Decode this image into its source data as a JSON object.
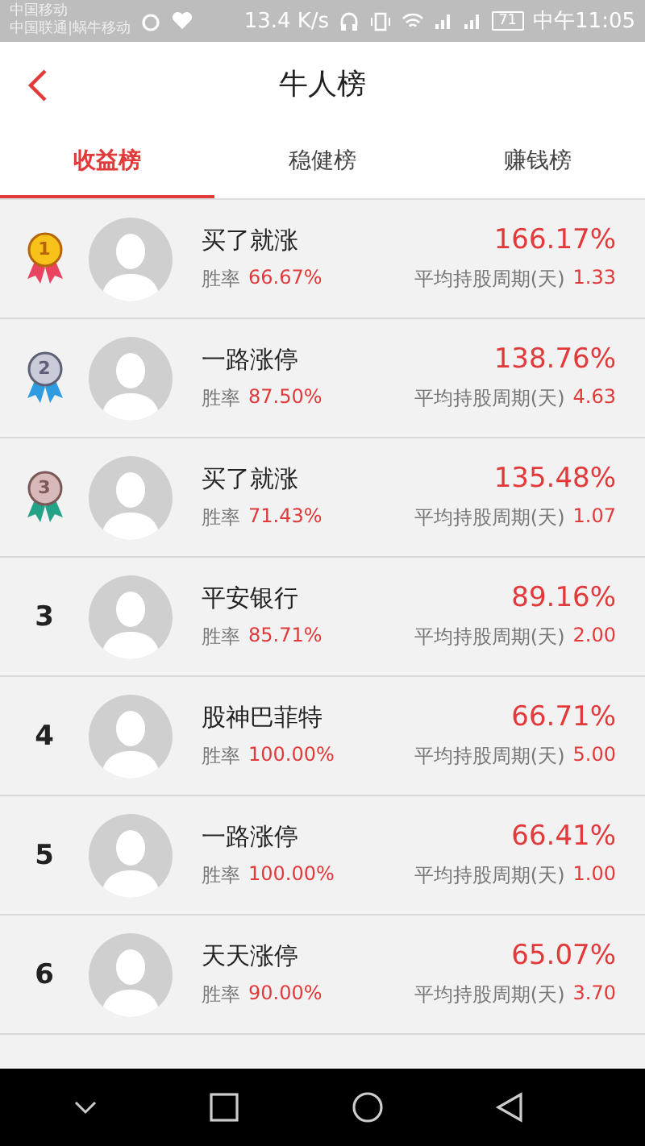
{
  "status_bar": {
    "carriers": [
      "中国移动",
      "中国联通|蜗牛移动"
    ],
    "speed": "13.4 K/s",
    "battery": "71",
    "time": "中午11:05"
  },
  "header": {
    "title": "牛人榜"
  },
  "tabs": [
    {
      "label": "收益榜",
      "selected": true
    },
    {
      "label": "稳健榜",
      "selected": false
    },
    {
      "label": "赚钱榜",
      "selected": false
    }
  ],
  "rows": [
    {
      "kind": "medal",
      "color": "#e94560",
      "rank": "1",
      "name": "买了就涨",
      "win_label": "胜率",
      "win_rate": "66.67%",
      "return": "166.17%",
      "period_label": "平均持股周期(天)",
      "period": "1.33"
    },
    {
      "kind": "medal",
      "color": "#2f9be0",
      "rank": "2",
      "name": "一路涨停",
      "win_label": "胜率",
      "win_rate": "87.50%",
      "return": "138.76%",
      "period_label": "平均持股周期(天)",
      "period": "4.63"
    },
    {
      "kind": "medal",
      "color": "#24a389",
      "rank": "3",
      "name": "买了就涨",
      "win_label": "胜率",
      "win_rate": "71.43%",
      "return": "135.48%",
      "period_label": "平均持股周期(天)",
      "period": "1.07"
    },
    {
      "kind": "number",
      "rank": "3",
      "name": "平安银行",
      "win_label": "胜率",
      "win_rate": "85.71%",
      "return": "89.16%",
      "period_label": "平均持股周期(天)",
      "period": "2.00"
    },
    {
      "kind": "number",
      "rank": "4",
      "name": "股神巴菲特",
      "win_label": "胜率",
      "win_rate": "100.00%",
      "return": "66.71%",
      "period_label": "平均持股周期(天)",
      "period": "5.00"
    },
    {
      "kind": "number",
      "rank": "5",
      "name": "一路涨停",
      "win_label": "胜率",
      "win_rate": "100.00%",
      "return": "66.41%",
      "period_label": "平均持股周期(天)",
      "period": "1.00"
    },
    {
      "kind": "number",
      "rank": "6",
      "name": "天天涨停",
      "win_label": "胜率",
      "win_rate": "90.00%",
      "return": "65.07%",
      "period_label": "平均持股周期(天)",
      "period": "3.70"
    }
  ]
}
